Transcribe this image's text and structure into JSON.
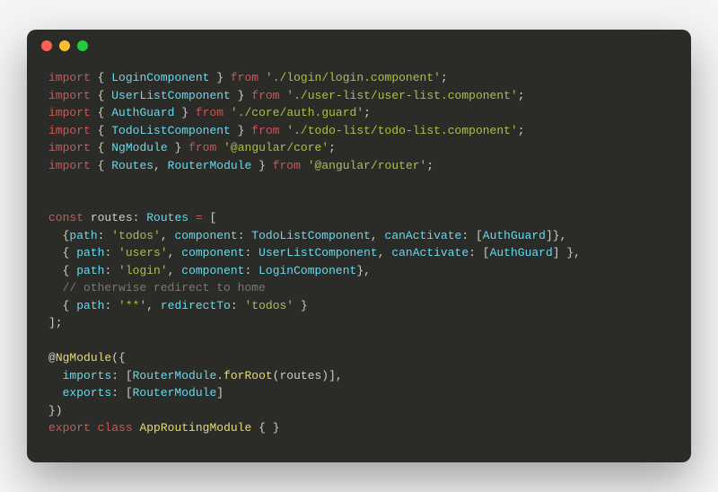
{
  "titlebar": {
    "dots": [
      "red",
      "yellow",
      "green"
    ]
  },
  "code": {
    "kw_import": "import",
    "kw_from": "from",
    "kw_const": "const",
    "kw_export": "export",
    "kw_class": "class",
    "LoginComponent": "LoginComponent",
    "UserListComponent": "UserListComponent",
    "AuthGuard": "AuthGuard",
    "TodoListComponent": "TodoListComponent",
    "NgModule": "NgModule",
    "Routes": "Routes",
    "RouterModule": "RouterModule",
    "str_login_path": "'./login/login.component'",
    "str_userlist_path": "'./user-list/user-list.component'",
    "str_authguard_path": "'./core/auth.guard'",
    "str_todolist_path": "'./todo-list/todo-list.component'",
    "str_angular_core": "'@angular/core'",
    "str_angular_router": "'@angular/router'",
    "routes_var": "routes",
    "prop_path": "path",
    "prop_component": "component",
    "prop_canActivate": "canActivate",
    "prop_redirectTo": "redirectTo",
    "prop_imports": "imports",
    "prop_exports": "exports",
    "str_todos": "'todos'",
    "str_users": "'users'",
    "str_login": "'login'",
    "str_wild": "'**'",
    "comment_redirect": "// otherwise redirect to home",
    "forRoot": "forRoot",
    "AppRoutingModule": "AppRoutingModule"
  }
}
